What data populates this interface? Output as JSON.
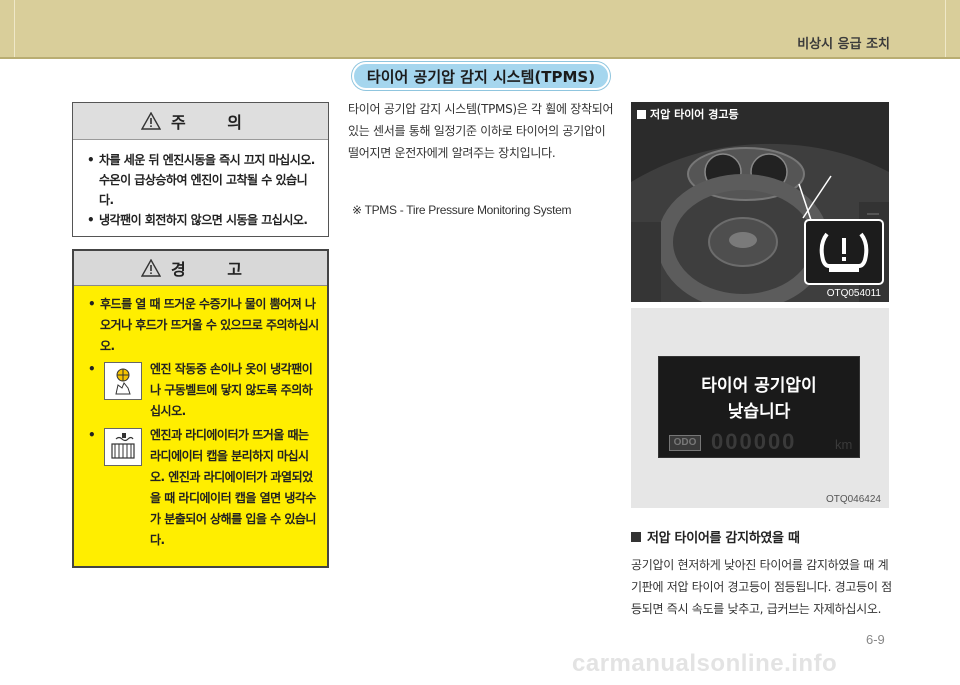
{
  "header": {
    "section_title": "비상시 응급 조치"
  },
  "title_pill": "타이어 공기압 감지 시스템(TPMS)",
  "caution": {
    "title": "주 의",
    "items": [
      "차를 세운 뒤 엔진시동을 즉시 끄지 마십시오. 수온이 급상승하여 엔진이 고착될 수 있습니다.",
      "냉각팬이 회전하지 않으면 시동을 끄십시오."
    ]
  },
  "warning": {
    "title": "경 고",
    "items": [
      "후드를 열 때 뜨거운 수증기나 물이 뿜어져 나오거나 후드가 뜨거울 수 있으므로 주의하십시오.",
      "엔진 작동중 손이나 옷이 냉각팬이나 구동벨트에 닿지 않도록 주의하십시오.",
      "엔진과 라디에이터가 뜨거울 때는 라디에이터 캡을 분리하지 마십시오. 엔진과 라디에이터가 과열되었을 때 라디에이터 캡을 열면 냉각수가 분출되어 상해를 입을 수 있습니다."
    ],
    "icons": [
      "fan-hand-hazard-icon",
      "hot-radiator-icon"
    ]
  },
  "intro_paragraph": "타이어 공기압 감지 시스템(TPMS)은 각 휠에 장착되어있는 센서를 통해 일정기준 이하로 타이어의 공기압이 떨어지면 운전자에게 알려주는 장치입니다.",
  "note": "※ TPMS - Tire Pressure Monitoring System",
  "photo1": {
    "label": "저압 타이어 경고등",
    "code": "OTQ054011",
    "icon": "tire-pressure-warning-icon"
  },
  "photo2": {
    "lcd_line1": "타이어 공기압이",
    "lcd_line2": "낮습니다",
    "odo_label": "ODO",
    "odo_value": "000000",
    "odo_unit": "km",
    "code": "OTQ046424"
  },
  "subsection": {
    "heading": "저압 타이어를 감지하였을 때",
    "text": "공기압이 현저하게 낮아진 타이어를 감지하였을 때 계기판에 저압 타이어 경고등이 점등됩니다. 경고등이 점등되면 즉시 속도를 낮추고, 급커브는 자제하십시오."
  },
  "page_number": "6-9",
  "watermark": "carmanualsonline.info",
  "colors": {
    "header_band": "#d9ce9a",
    "pill": "#a5d6ee",
    "warning_bg": "#ffee00"
  }
}
